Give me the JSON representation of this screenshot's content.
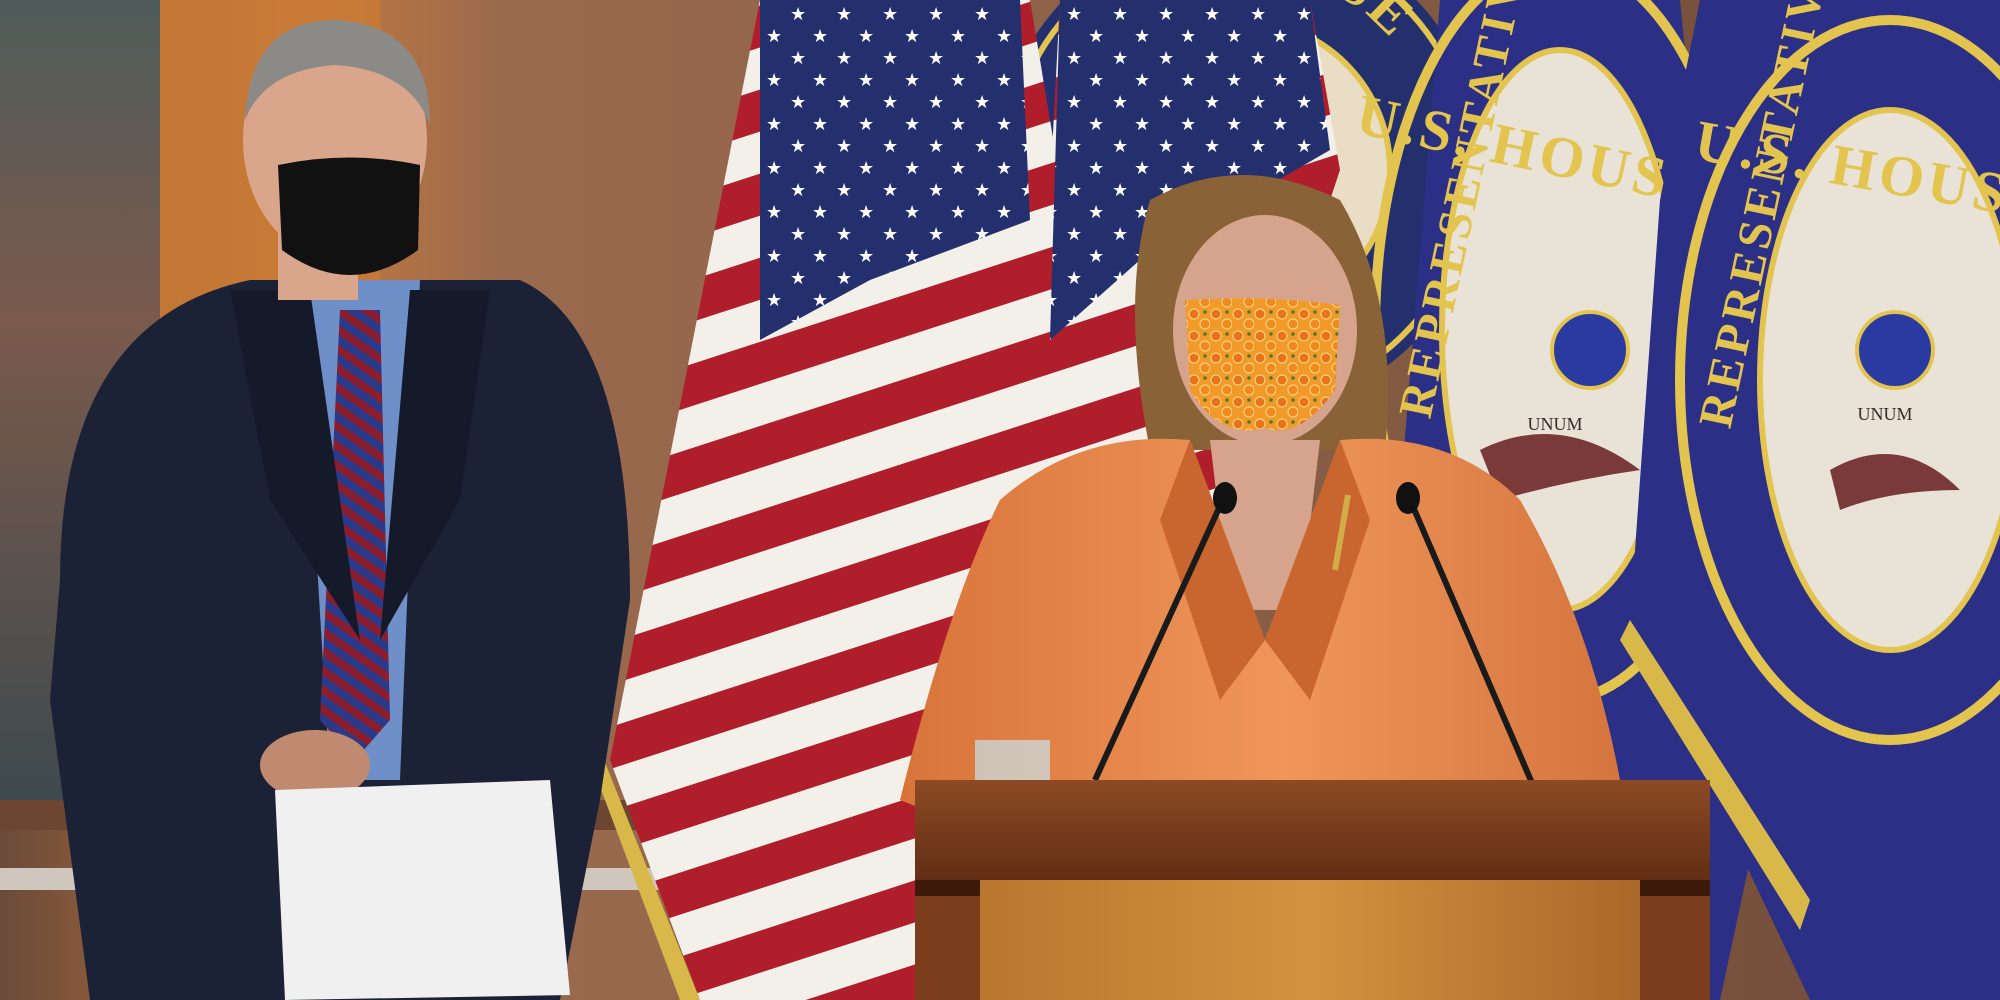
{
  "scene": {
    "wall_seal": {
      "text": "U.S. HOUSE"
    },
    "flag_seal_1": {
      "top_text": "U.S. HOUSE",
      "side_text": "REPRESENTATIVES",
      "ribbon_text": "UNUM"
    },
    "flag_seal_2": {
      "top_text": "U.S. HOUSE",
      "side_text": "REPRESENTATIVES",
      "ribbon_text": "UNUM"
    }
  },
  "colors": {
    "wall": "#8a5f45",
    "left_panel": "#c97a35",
    "suit_navy": "#1b2236",
    "suit_orange": "#e8894a",
    "podium": "#7b3d1c",
    "flag_blue": "#2c2f86",
    "flag_red": "#b01e2b",
    "fringe_gold": "#d9b84a"
  }
}
